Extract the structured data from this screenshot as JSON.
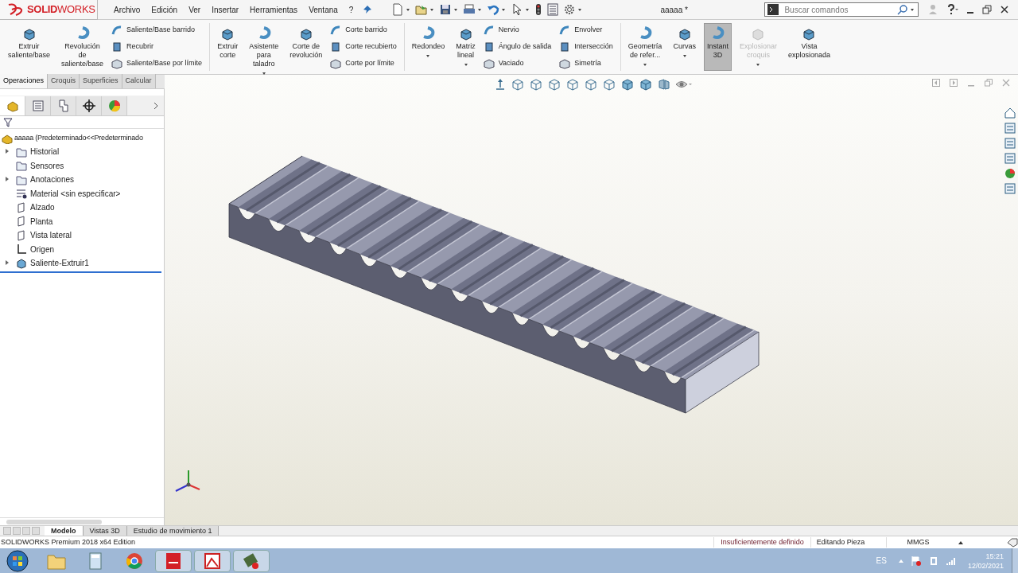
{
  "title_bar": {
    "logo": "**SOLID**WORKS",
    "menu": [
      "Archivo",
      "Edición",
      "Ver",
      "Insertar",
      "Herramientas",
      "Ventana",
      "?"
    ],
    "document_title": "aaaaa *",
    "search": {
      "placeholder": "Buscar comandos"
    }
  },
  "ribbon": {
    "sections": [
      {
        "groups": [
          {
            "kind": "large",
            "label": "Extruir saliente/base",
            "caret": false,
            "selected": false,
            "disabled": false
          },
          {
            "kind": "large",
            "label": "Revolución de saliente/base",
            "caret": false,
            "selected": false,
            "disabled": false
          },
          {
            "kind": "stack",
            "items": [
              "Saliente/Base barrido",
              "Recubrir",
              "Saliente/Base por límite"
            ]
          }
        ]
      },
      {
        "groups": [
          {
            "kind": "large",
            "label": "Extruir corte",
            "caret": false,
            "selected": false,
            "disabled": false
          },
          {
            "kind": "large",
            "label": "Asistente para taladro",
            "caret": true,
            "selected": false,
            "disabled": false
          },
          {
            "kind": "large",
            "label": "Corte de revolución",
            "caret": false,
            "selected": false,
            "disabled": false
          },
          {
            "kind": "stack",
            "items": [
              "Corte barrido",
              "Corte recubierto",
              "Corte por límite"
            ]
          }
        ]
      },
      {
        "groups": [
          {
            "kind": "large",
            "label": "Redondeo",
            "caret": true,
            "selected": false,
            "disabled": false
          },
          {
            "kind": "large",
            "label": "Matriz lineal",
            "caret": true,
            "selected": false,
            "disabled": false
          },
          {
            "kind": "stack",
            "items": [
              "Nervio",
              "Ángulo de salida",
              "Vaciado"
            ]
          },
          {
            "kind": "stack",
            "items": [
              "Envolver",
              "Intersección",
              "Simetría"
            ]
          }
        ]
      },
      {
        "groups": [
          {
            "kind": "large",
            "label": "Geometría de refer...",
            "caret": true,
            "selected": false,
            "disabled": false
          },
          {
            "kind": "large",
            "label": "Curvas",
            "caret": true,
            "selected": false,
            "disabled": false
          },
          {
            "kind": "large",
            "label": "Instant 3D",
            "caret": false,
            "selected": true,
            "disabled": false
          },
          {
            "kind": "large",
            "label": "Explosionar croquis",
            "caret": true,
            "selected": false,
            "disabled": true
          },
          {
            "kind": "large",
            "label": "Vista explosionada",
            "caret": false,
            "selected": false,
            "disabled": false
          }
        ]
      }
    ]
  },
  "command_tabs": [
    {
      "label": "Operaciones",
      "selected": true
    },
    {
      "label": "Croquis",
      "selected": false
    },
    {
      "label": "Superficies",
      "selected": false
    },
    {
      "label": "Calcular",
      "selected": false
    }
  ],
  "feature_tree": {
    "root": "aaaaa (Predeterminado<<Predeterminado",
    "items": [
      {
        "label": "Historial",
        "kind": "folder",
        "collapsed": true
      },
      {
        "label": "Sensores",
        "kind": "folder",
        "collapsed": false
      },
      {
        "label": "Anotaciones",
        "kind": "folder",
        "collapsed": true
      },
      {
        "label": "Material <sin especificar>",
        "kind": "material",
        "collapsed": false
      },
      {
        "label": "Alzado",
        "kind": "plane",
        "collapsed": false
      },
      {
        "label": "Planta",
        "kind": "plane",
        "collapsed": false
      },
      {
        "label": "Vista lateral",
        "kind": "plane",
        "collapsed": false
      },
      {
        "label": "Origen",
        "kind": "origin",
        "collapsed": false
      },
      {
        "label": "Saliente-Extruir1",
        "kind": "feature",
        "collapsed": true
      }
    ]
  },
  "bottom_tabs": [
    {
      "label": "Modelo",
      "selected": true
    },
    {
      "label": "Vistas 3D",
      "selected": false
    },
    {
      "label": "Estudio de movimiento 1",
      "selected": false
    }
  ],
  "status_bar": {
    "text": "SOLIDWORKS Premium 2018 x64 Edition",
    "fields": [
      "Insuficientemente definido",
      "Editando Pieza",
      "MMGS"
    ]
  },
  "taskbar": {
    "language": "ES",
    "time": "15:21",
    "date": "12/02/2021"
  }
}
